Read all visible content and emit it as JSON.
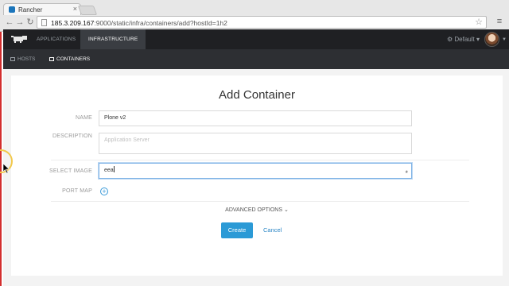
{
  "browser": {
    "tab_title": "Rancher",
    "tab_close": "×",
    "url_host": "185.3.209.167",
    "url_rest": ":9000/static/infra/containers/add?hostId=1h2",
    "back_icon": "back-arrow-icon",
    "forward_icon": "forward-arrow-icon",
    "reload_icon": "reload-icon",
    "star_icon": "star-icon",
    "menu_icon": "hamburger-menu-icon"
  },
  "app_nav": {
    "items": [
      {
        "label": "APPLICATIONS",
        "active": false
      },
      {
        "label": "INFRASTRUCTURE",
        "active": true
      }
    ],
    "environment": "Default",
    "logo": "rancher-logo"
  },
  "sub_nav": {
    "items": [
      {
        "label": "HOSTS",
        "active": false
      },
      {
        "label": "CONTAINERS",
        "active": true
      }
    ]
  },
  "form": {
    "title": "Add Container",
    "name_label": "NAME",
    "name_value": "Plone v2",
    "description_label": "DESCRIPTION",
    "description_placeholder": "Application Server",
    "image_label": "SELECT IMAGE",
    "image_value": "eea",
    "image_required": "*",
    "port_map_label": "PORT MAP",
    "port_add": "+",
    "advanced_options": "ADVANCED OPTIONS ⌄",
    "create_label": "Create",
    "cancel_label": "Cancel"
  },
  "colors": {
    "accent": "#2b9ad6",
    "navbar": "#1f2023",
    "subnav": "#2d2f33"
  }
}
